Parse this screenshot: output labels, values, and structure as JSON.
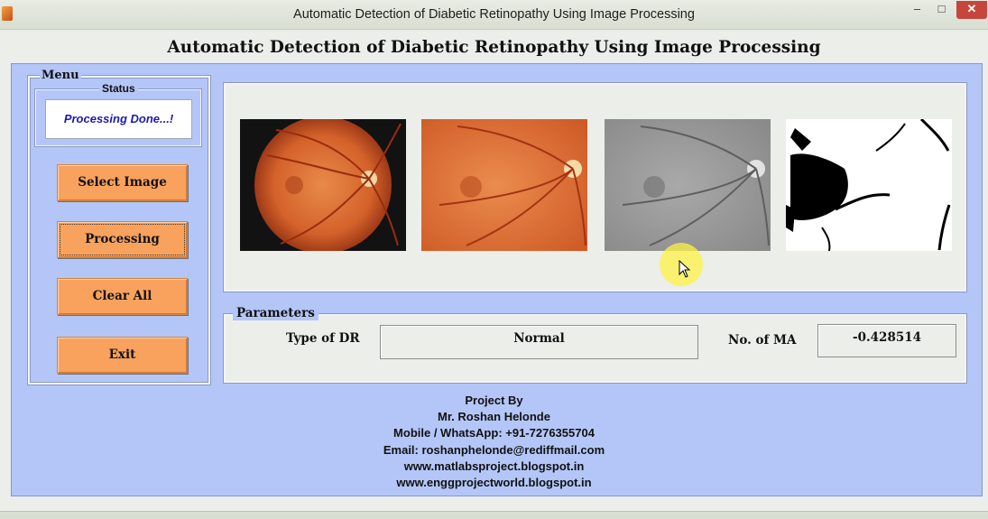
{
  "window": {
    "title": "Automatic Detection of Diabetic Retinopathy  Using Image Processing",
    "minimize_icon": "minimize-icon",
    "maximize_icon": "maximize-icon",
    "close_icon": "close-icon",
    "min_glyph": "–",
    "max_glyph": "□",
    "close_glyph": "✕"
  },
  "heading": "Automatic Detection of Diabetic Retinopathy Using Image Processing",
  "menu": {
    "title": "Menu",
    "status": {
      "title": "Status",
      "text": "Processing Done...!"
    },
    "buttons": {
      "select_image": "Select Image",
      "processing": "Processing",
      "clear_all": "Clear All",
      "exit": "Exit"
    }
  },
  "images": [
    {
      "name": "original-fundus-image"
    },
    {
      "name": "cropped-fundus-image"
    },
    {
      "name": "grayscale-fundus-image"
    },
    {
      "name": "binary-segmented-image"
    }
  ],
  "parameters": {
    "title": "Parameters",
    "type_of_dr_label": "Type of DR",
    "type_of_dr_value": "Normal",
    "no_of_ma_label": "No. of MA",
    "no_of_ma_value": "-0.428514"
  },
  "credits": {
    "line1": "Project By",
    "line2": "Mr. Roshan Helonde",
    "line3": "Mobile / WhatsApp: +91-7276355704",
    "line4": "Email: roshanphelonde@rediffmail.com",
    "line5": "www.matlabsproject.blogspot.in",
    "line6": "www.enggprojectworld.blogspot.in"
  },
  "colors": {
    "panel_bg": "#b4c6f7",
    "button_bg": "#f9a25d",
    "status_text": "#1b1bb0",
    "close_button": "#c7463b"
  }
}
